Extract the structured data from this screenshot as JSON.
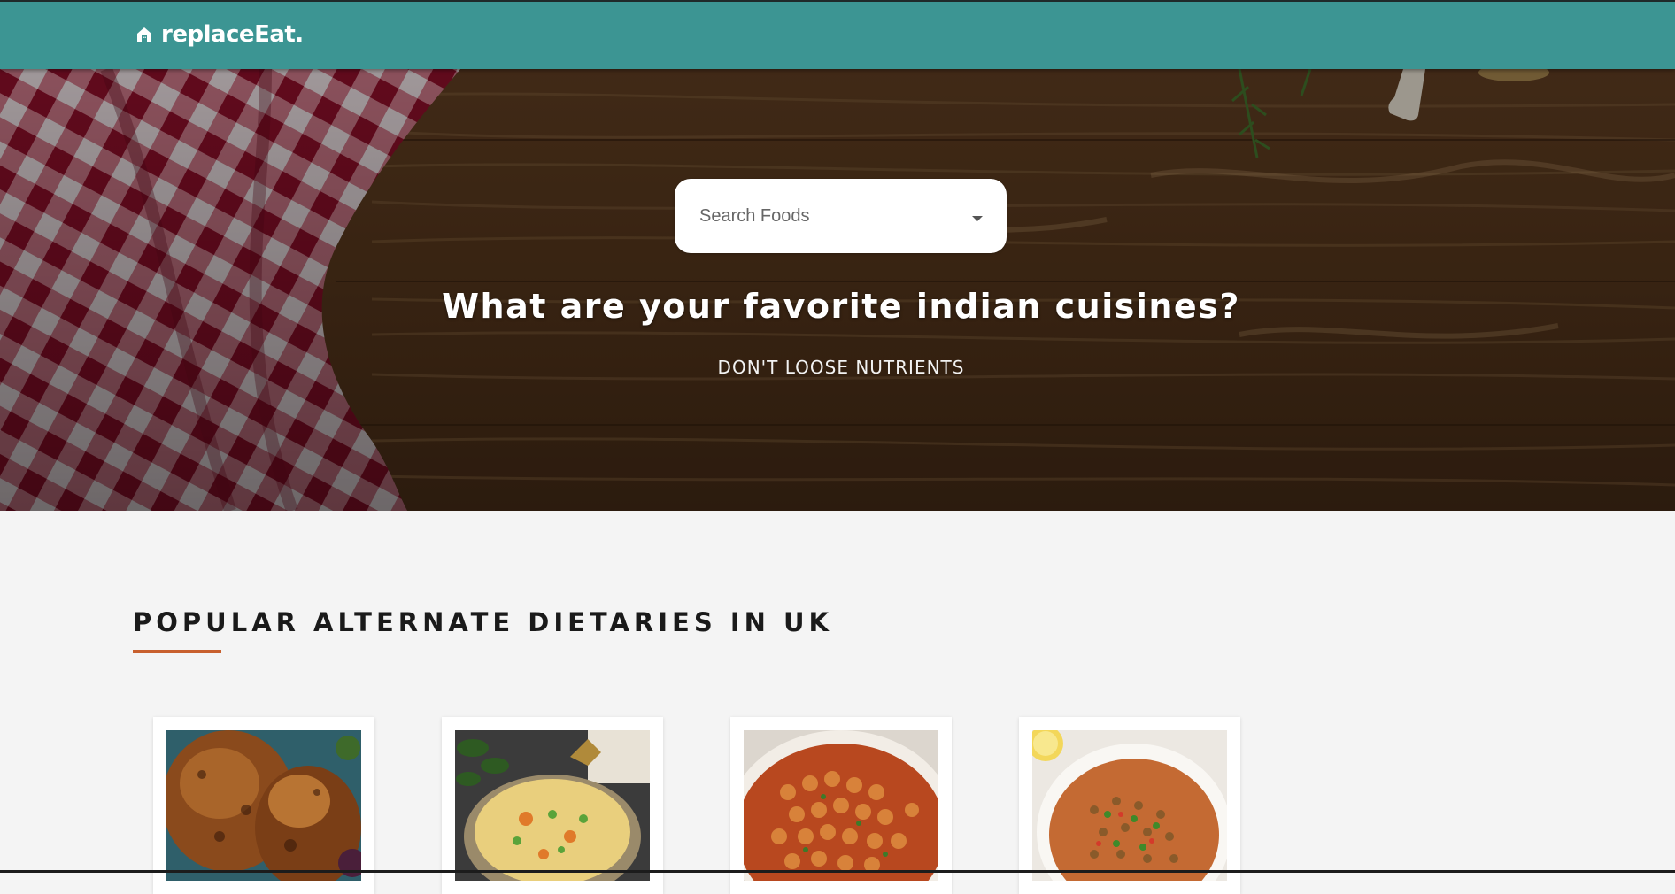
{
  "brand": {
    "name": "replaceEat.",
    "icon": "home-icon"
  },
  "colors": {
    "navbar": "#3c9593",
    "accent": "#c8602e",
    "page_background": "#f4f4f4"
  },
  "hero": {
    "background": "wooden-table-with-checkered-cloth",
    "search": {
      "placeholder": "Search Foods",
      "value": "",
      "dropdown_icon": "caret-down-icon"
    },
    "title": "What are your favorite indian cuisines?",
    "subtitle": "DON'T LOOSE NUTRIENTS"
  },
  "popular": {
    "title": "POPULAR ALTERNATE DIETARIES IN UK",
    "cards": [
      {
        "image": "roast-chicken"
      },
      {
        "image": "vegetable-curry"
      },
      {
        "image": "chickpea-curry"
      },
      {
        "image": "lentil-soup"
      }
    ]
  }
}
